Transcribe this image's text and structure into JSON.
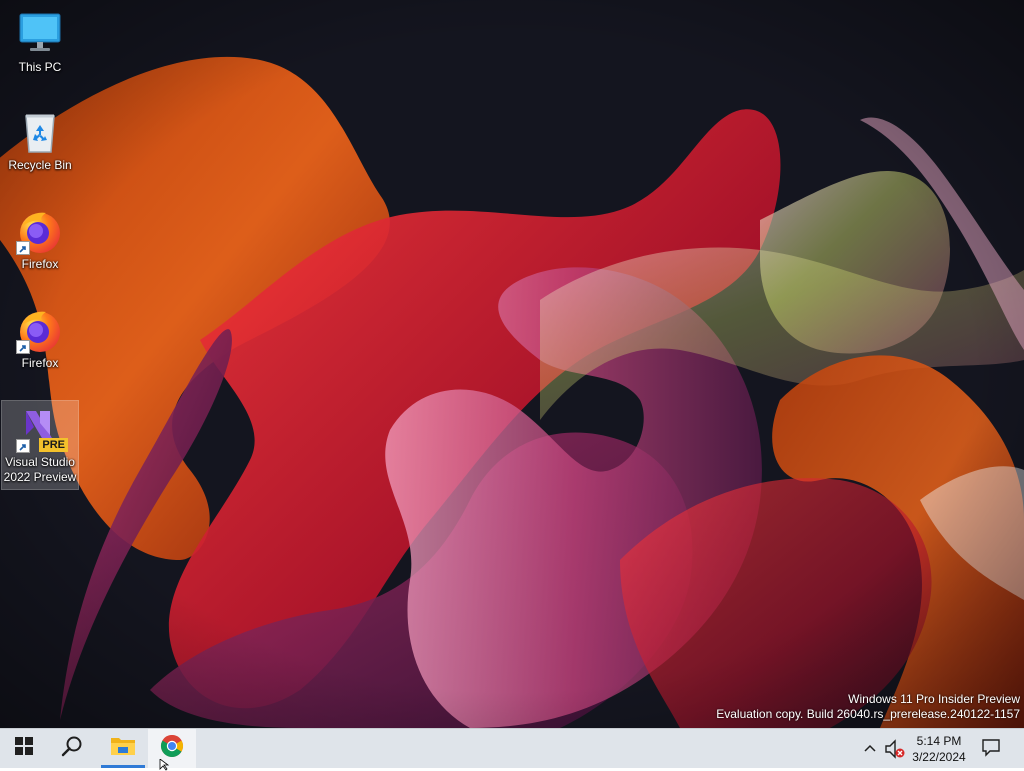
{
  "desktop": {
    "icons": [
      {
        "label": "This PC",
        "icon": "computer-monitor-icon"
      },
      {
        "label": "Recycle Bin",
        "icon": "recycle-bin-icon"
      },
      {
        "label": "Firefox",
        "icon": "firefox-icon"
      },
      {
        "label": "Firefox",
        "icon": "firefox-icon"
      },
      {
        "label": "Visual Studio 2022 Preview",
        "icon": "visual-studio-preview-icon",
        "badge": "PRE"
      }
    ],
    "watermark": {
      "line1": "Windows 11 Pro Insider Preview",
      "line2": "Evaluation copy. Build 26040.rs_prerelease.240122-1157"
    }
  },
  "taskbar": {
    "buttons": [
      {
        "name": "start",
        "icon": "windows-logo-icon"
      },
      {
        "name": "search",
        "icon": "search-icon"
      },
      {
        "name": "file-explorer",
        "icon": "folder-icon"
      },
      {
        "name": "chrome",
        "icon": "chrome-icon"
      }
    ],
    "tray": {
      "time": "5:14 PM",
      "date": "3/22/2024",
      "chevron_icon": "chevron-up-icon",
      "volume_icon": "speaker-muted-icon",
      "notification_icon": "notification-icon"
    }
  },
  "colors": {
    "taskbar_bg": "#dfe4ea",
    "active_indicator": "#2f7ad6",
    "wallpaper_bg": "#14151f"
  }
}
